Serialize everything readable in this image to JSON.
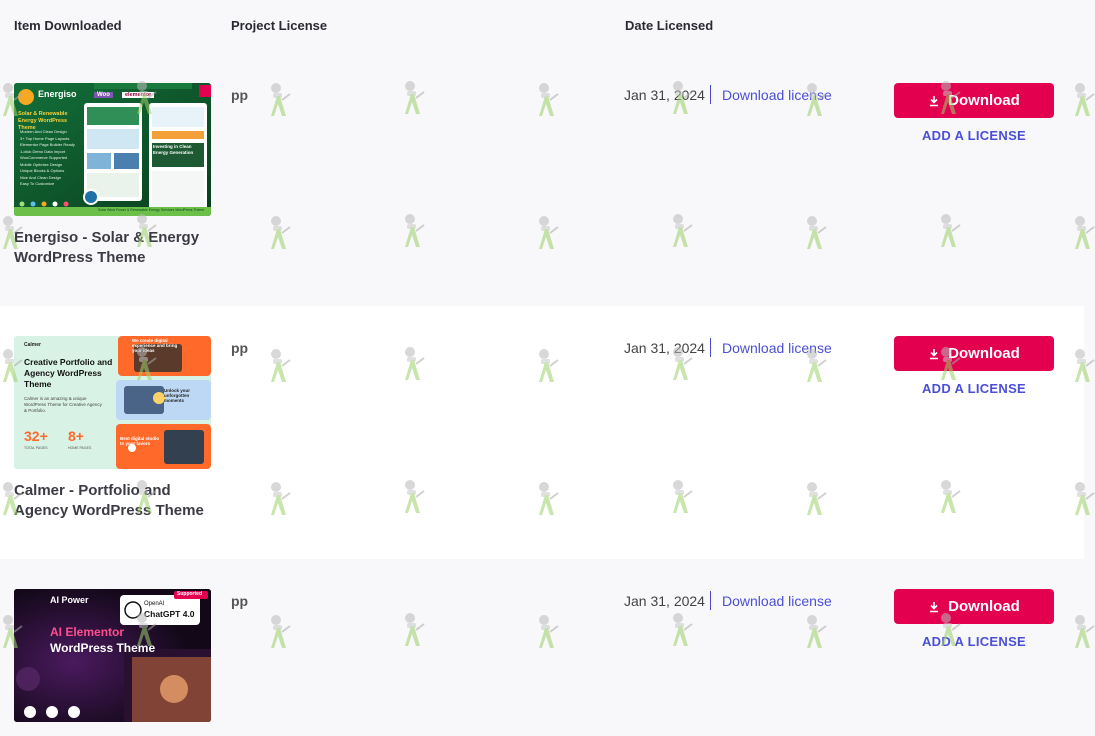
{
  "table": {
    "headers": {
      "item": "Item Downloaded",
      "license": "Project License",
      "date": "Date Licensed"
    },
    "rows": [
      {
        "title": "Energiso - Solar & Energy WordPress Theme",
        "license": "pp",
        "date": "Jan 31, 2024",
        "download_link": "Download license",
        "download_button": "Download",
        "add_license": "ADD A LICENSE",
        "thumb": {
          "brand": "Energiso",
          "headline": "Solar & Renewable Energy WordPress Theme",
          "features": [
            "Modern And Clean Design",
            "3+ Top Home Page Layouts",
            "Elementor Page Builder Ready",
            "1-click Demo Data Import",
            "WooCommerce Supported",
            "Mobile Optimize Design",
            "Unique Blocks & Options",
            "Nice And Clean Design",
            "Easy To Customize"
          ],
          "badge1": "Woo",
          "badge2": "elementor",
          "hero": "Investing in Clean Energy Generation",
          "footer": "Solar Wind Power & Renewable Energy Services WordPress Theme"
        }
      },
      {
        "title": "Calmer - Portfolio and Agency WordPress Theme",
        "license": "pp",
        "date": "Jan 31, 2024",
        "download_link": "Download license",
        "download_button": "Download",
        "add_license": "ADD A LICENSE",
        "thumb": {
          "brand": "Calmer",
          "headline": "Creative Portfolio and Agency WordPress Theme",
          "desc": "Calmer is an amazing & unique WordPress Theme for Creative Agency & Portfolio.",
          "stat1": "32+",
          "stat1_label": "TOTAL PAGES",
          "stat2": "8+",
          "stat2_label": "HOME PAGES",
          "card1": "We create digital experience and bring your ideas",
          "card2": "Unlock your unforgotten moments",
          "card3": "Best digital studio to your favors"
        }
      },
      {
        "title": "",
        "license": "pp",
        "date": "Jan 31, 2024",
        "download_link": "Download license",
        "download_button": "Download",
        "add_license": "ADD A LICENSE",
        "thumb": {
          "brand": "AI Power",
          "badge": "Supported",
          "openai": "OpenAI",
          "chatgpt": "ChatGPT 4.0",
          "line1": "AI Elementor",
          "line2": "WordPress Theme"
        }
      }
    ]
  },
  "colors": {
    "primary": "#e3004f",
    "link": "#4b4fd6",
    "energy_green": "#0f5a2c",
    "calmer_mint": "#d9f2e6",
    "calmer_orange": "#ff6a2b",
    "ai_dark": "#140b1e"
  },
  "icons": {
    "download": "download-icon",
    "watermark": "watermark-figure-icon"
  }
}
